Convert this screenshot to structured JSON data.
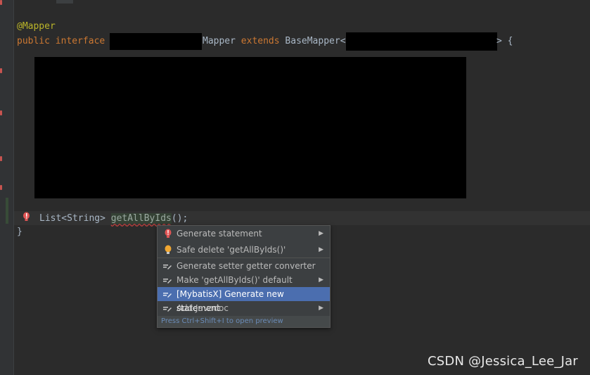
{
  "editor": {
    "annotation": "@Mapper",
    "kw_public": "public",
    "kw_interface": "interface",
    "mapper_suffix": "Mapper",
    "kw_extends": "extends",
    "base_mapper": "BaseMapper<",
    "open_brace": "> {",
    "method_return": "List<String>",
    "method_name": "getAllByIds",
    "method_tail": "();",
    "close_brace": "}"
  },
  "popup": {
    "items": [
      {
        "label": "Generate statement",
        "icon": "error-bulb-icon",
        "submenu": true
      },
      {
        "label": "Safe delete 'getAllByIds()'",
        "icon": "lightbulb-icon",
        "submenu": true
      },
      {
        "label": "Generate setter getter converter",
        "icon": "edit-intention-icon",
        "submenu": false
      },
      {
        "label": "Make 'getAllByIds()' default",
        "icon": "edit-intention-icon",
        "submenu": true
      },
      {
        "label": "[MybatisX] Generate new statement",
        "icon": "edit-intention-icon",
        "submenu": false
      },
      {
        "label": "Add Javadoc",
        "icon": "edit-intention-icon",
        "submenu": true
      }
    ],
    "footer": "Press Ctrl+Shift+I to open preview",
    "selected_color": "#4b6eaf"
  },
  "watermark": "CSDN @Jessica_Lee_Jar"
}
